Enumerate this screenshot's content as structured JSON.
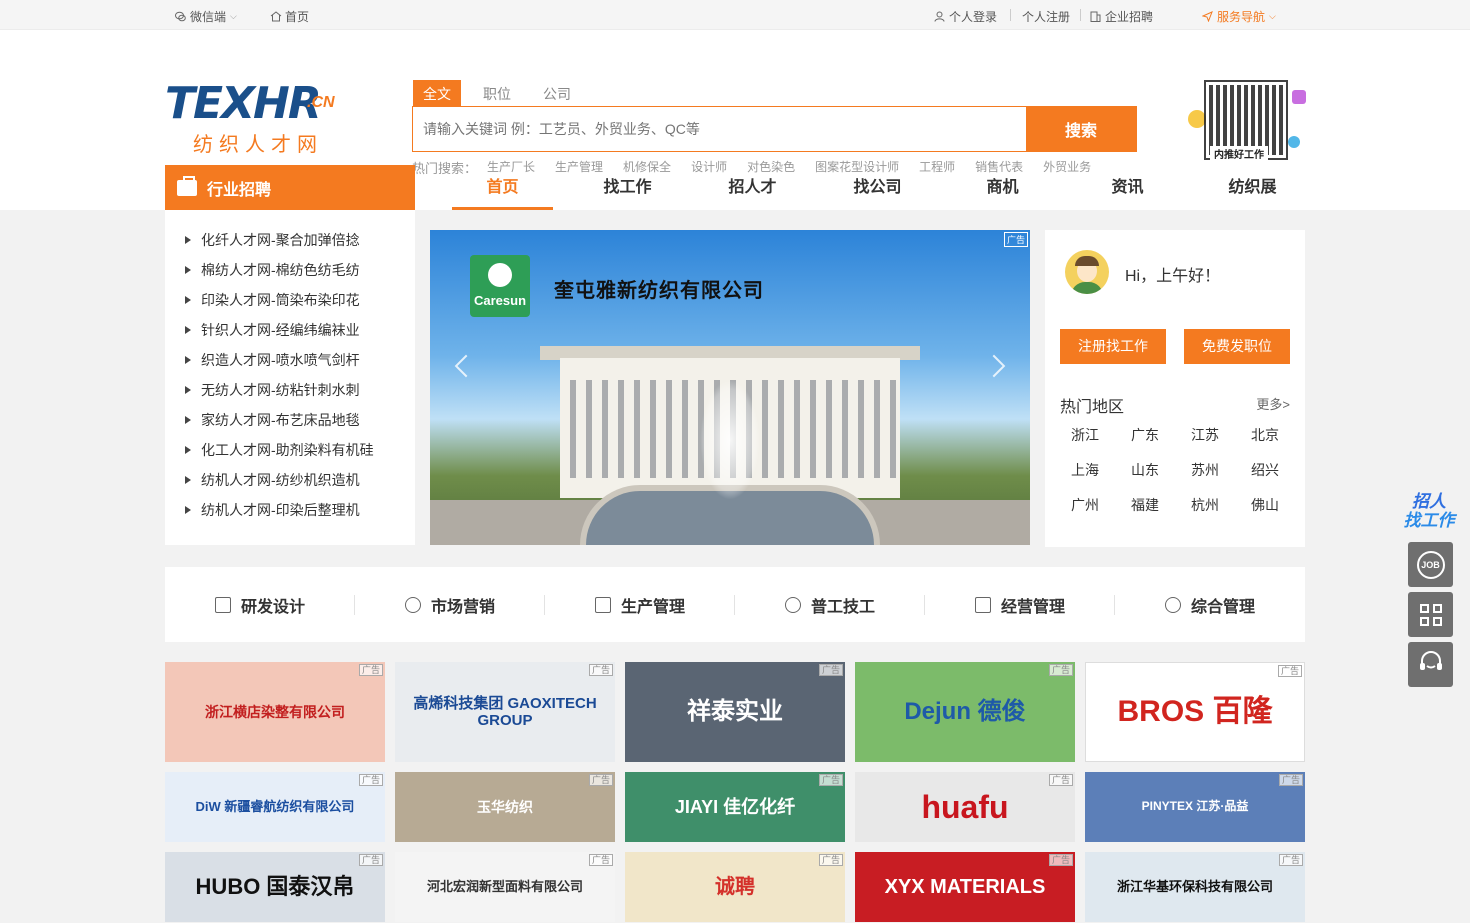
{
  "topbar": {
    "wechat": "微信端",
    "home": "首页",
    "login": "个人登录",
    "register": "个人注册",
    "enterprise": "企业招聘",
    "service_nav": "服务导航"
  },
  "logo": {
    "brand_a": "TEX",
    "brand_b": "HR",
    "brand_cn": ".CN",
    "subtitle": "纺织人才网"
  },
  "search": {
    "tabs": [
      "全文",
      "职位",
      "公司"
    ],
    "placeholder": "请输入关键词 例：工艺员、外贸业务、QC等",
    "button": "搜索",
    "hot_label": "热门搜索：",
    "hot_keywords": [
      "生产厂长",
      "生产管理",
      "机修保全",
      "设计师",
      "对色染色",
      "图案花型设计师",
      "工程师",
      "销售代表",
      "外贸业务"
    ]
  },
  "qr": {
    "caption": "内推好工作"
  },
  "category_button": "行业招聘",
  "nav": [
    "首页",
    "找工作",
    "招人才",
    "找公司",
    "商机",
    "资讯",
    "纺织展"
  ],
  "categories": [
    "化纤人才网-聚合加弹倍捻",
    "棉纺人才网-棉纺色纺毛纺",
    "印染人才网-筒染布染印花",
    "针织人才网-经编纬编袜业",
    "织造人才网-喷水喷气剑杆",
    "无纺人才网-纺粘针刺水刺",
    "家纺人才网-布艺床品地毯",
    "化工人才网-助剂染料有机硅",
    "纺机人才网-纺纱机织造机",
    "纺机人才网-印染后整理机"
  ],
  "banner": {
    "ad_tag": "广告",
    "logo_text": "Caresun",
    "company": "奎屯雅新纺织有限公司"
  },
  "user": {
    "greeting": "Hi，上午好！",
    "btn_job": "注册找工作",
    "btn_post": "免费发职位",
    "hot_area_title": "热门地区",
    "more": "更多>",
    "areas": [
      "浙江",
      "广东",
      "江苏",
      "北京",
      "上海",
      "山东",
      "苏州",
      "绍兴",
      "广州",
      "福建",
      "杭州",
      "佛山"
    ]
  },
  "job_categories": [
    "研发设计",
    "市场营销",
    "生产管理",
    "普工技工",
    "经营管理",
    "综合管理"
  ],
  "ads": {
    "tag": "广告",
    "row1": [
      {
        "text": "浙江横店染整有限公司",
        "bg": "#f3c7b8",
        "color": "#c21f1f"
      },
      {
        "text": "高烯科技集团 GAOXITECH GROUP",
        "bg": "#e9ecef",
        "color": "#1b4a95"
      },
      {
        "text": "祥泰实业",
        "bg": "#5a6573",
        "color": "#ffffff"
      },
      {
        "text": "Dejun 德俊",
        "bg": "#7cbb6a",
        "color": "#1e5aa8"
      },
      {
        "text": "BROS 百隆",
        "bg": "#ffffff",
        "color": "#d1251f"
      }
    ],
    "row2": [
      {
        "text": "DiW 新疆睿航纺织有限公司",
        "bg": "#e6eef8",
        "color": "#1c4fa0"
      },
      {
        "text": "玉华纺织",
        "bg": "#b7aa94",
        "color": "#ffffff"
      },
      {
        "text": "JIAYI 佳亿化纤",
        "bg": "#3f8f6a",
        "color": "#ffffff"
      },
      {
        "text": "huafu",
        "bg": "#e8e8e8",
        "color": "#c8161e"
      },
      {
        "text": "PINYTEX 江苏·品益",
        "bg": "#5c7fb8",
        "color": "#ffffff"
      }
    ],
    "row3": [
      {
        "text": "HUBO 国泰汉帛",
        "bg": "#d9dfe6",
        "color": "#111111"
      },
      {
        "text": "河北宏润新型面料有限公司",
        "bg": "#f4f4f4",
        "color": "#333333"
      },
      {
        "text": "诚聘",
        "bg": "#f1e6c9",
        "color": "#d4312b"
      },
      {
        "text": "XYX MATERIALS",
        "bg": "#c81d23",
        "color": "#ffffff"
      },
      {
        "text": "浙江华基环保科技有限公司",
        "bg": "#dfe8ef",
        "color": "#111111"
      }
    ]
  },
  "float": {
    "promo_line1": "招人",
    "promo_line2": "找工作",
    "job": "JOB"
  }
}
